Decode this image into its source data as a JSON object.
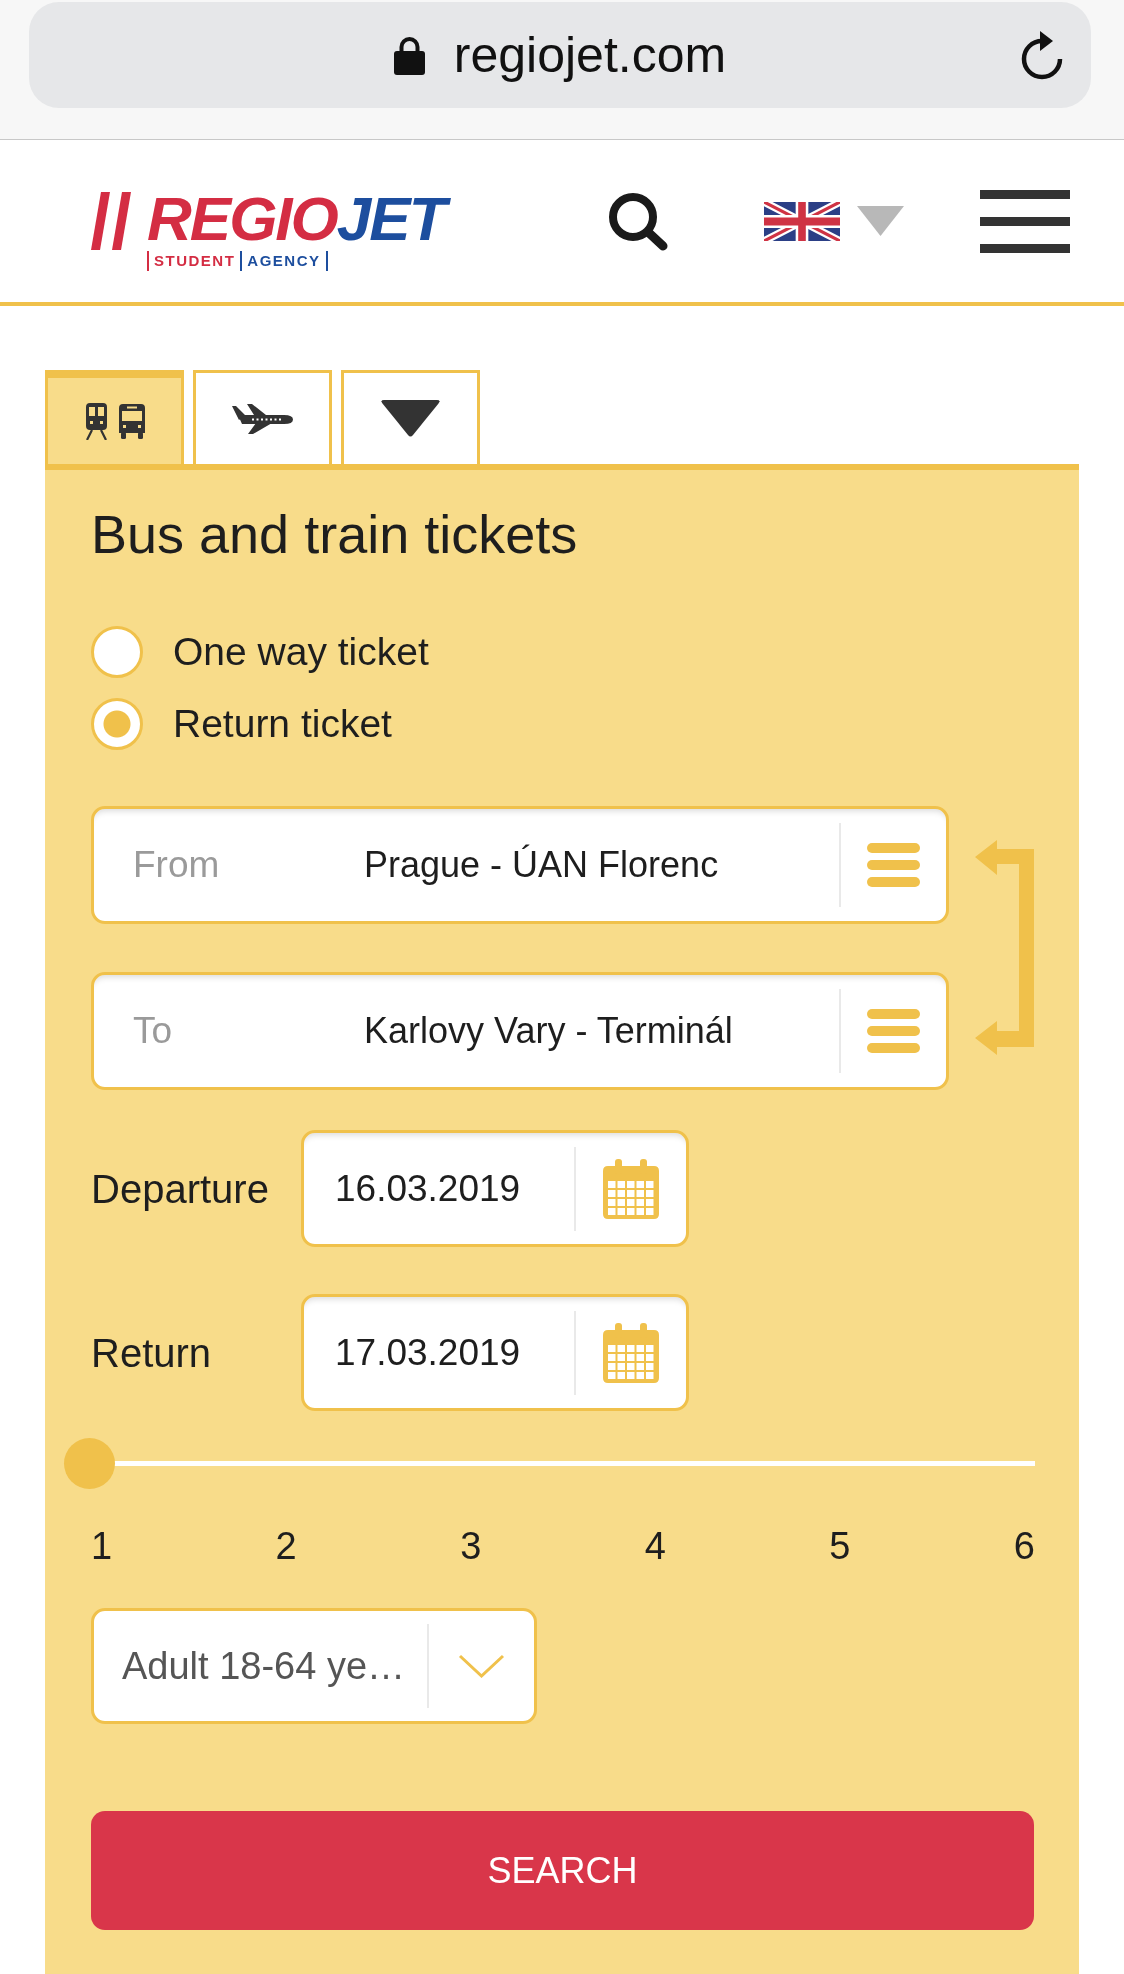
{
  "browser": {
    "url": "regiojet.com"
  },
  "header": {
    "logo": {
      "wordmark": [
        "REGIO",
        "JET"
      ],
      "tagline": [
        "STUDENT",
        "AGENCY"
      ]
    }
  },
  "tabs": [
    {
      "kind": "bus_train",
      "selected": true
    },
    {
      "kind": "flight",
      "selected": false
    },
    {
      "kind": "more",
      "selected": false
    }
  ],
  "form": {
    "title": "Bus and train tickets",
    "trip_types": [
      {
        "label": "One way ticket",
        "selected": false
      },
      {
        "label": "Return ticket",
        "selected": true
      }
    ],
    "stations": [
      {
        "label": "From",
        "value": "Prague - ÚAN Florenc"
      },
      {
        "label": "To",
        "value": "Karlovy Vary - Terminál"
      }
    ],
    "dates": [
      {
        "label": "Departure",
        "value": "16.03.2019"
      },
      {
        "label": "Return",
        "value": "17.03.2019"
      }
    ],
    "passenger_count": {
      "level": 0,
      "ticks": [
        "1",
        "2",
        "3",
        "4",
        "5",
        "6"
      ]
    },
    "passenger_type": {
      "value": "Adult 18-64 ye…"
    },
    "search_button": "SEARCH"
  }
}
